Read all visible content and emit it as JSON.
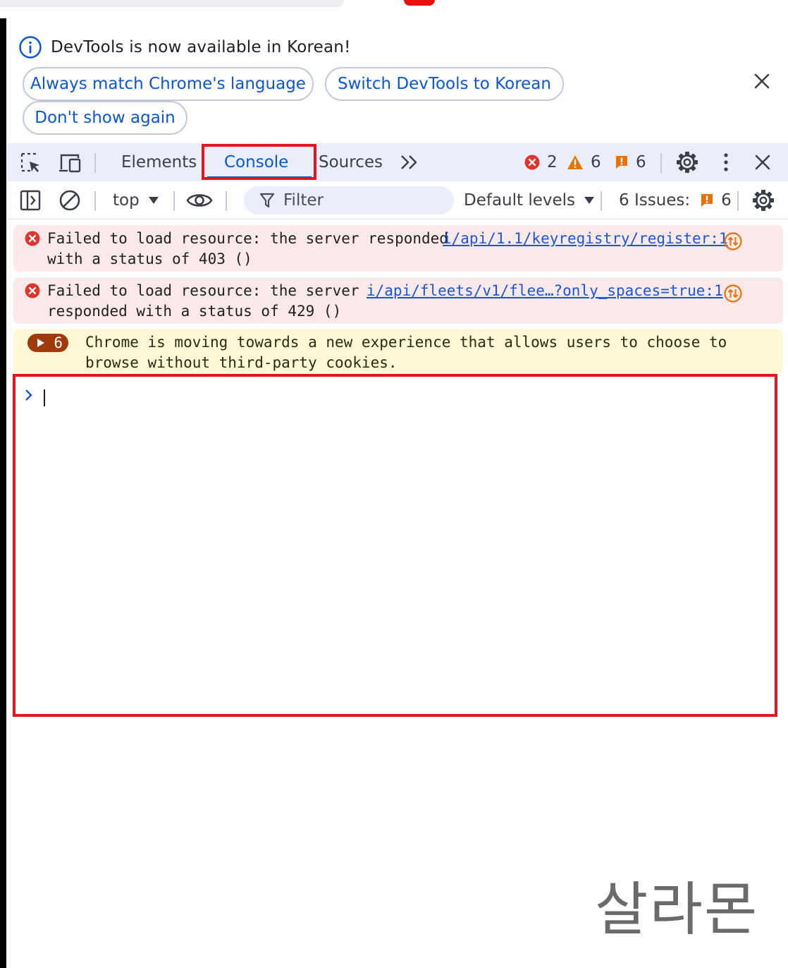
{
  "infobar": {
    "message": "DevTools is now available in Korean!",
    "buttons": {
      "always_match": "Always match Chrome's language",
      "switch": "Switch DevTools to Korean",
      "dont_show": "Don't show again"
    }
  },
  "tabs": {
    "elements": "Elements",
    "console": "Console",
    "sources": "Sources"
  },
  "counters": {
    "errors": "2",
    "warnings": "6",
    "issues": "6"
  },
  "console_toolbar": {
    "context": "top",
    "filter_placeholder": "Filter",
    "levels": "Default levels",
    "issues_label": "6 Issues:",
    "issues_count": "6"
  },
  "messages": [
    {
      "level": "error",
      "line1": "Failed to load resource: the server responded",
      "line2": "with a status of 403 ()",
      "source": "i/api/1.1/keyregistry/register:1"
    },
    {
      "level": "error",
      "line1": "Failed to load resource: the server",
      "line2": "responded with a status of 429 ()",
      "source": "i/api/fleets/v1/flee…?only_spaces=true:1"
    },
    {
      "level": "warning",
      "count": "6",
      "line1": "Chrome is moving towards a new experience that allows users to choose to",
      "line2": "browse without third-party cookies."
    }
  ],
  "watermark": "살라몬",
  "colors": {
    "accent": "#0b57d0",
    "highlight": "#e2161e",
    "error_bg": "#fbe9e9",
    "warning_bg": "#fff8d6",
    "toolbar_bg": "#e9eef8"
  }
}
